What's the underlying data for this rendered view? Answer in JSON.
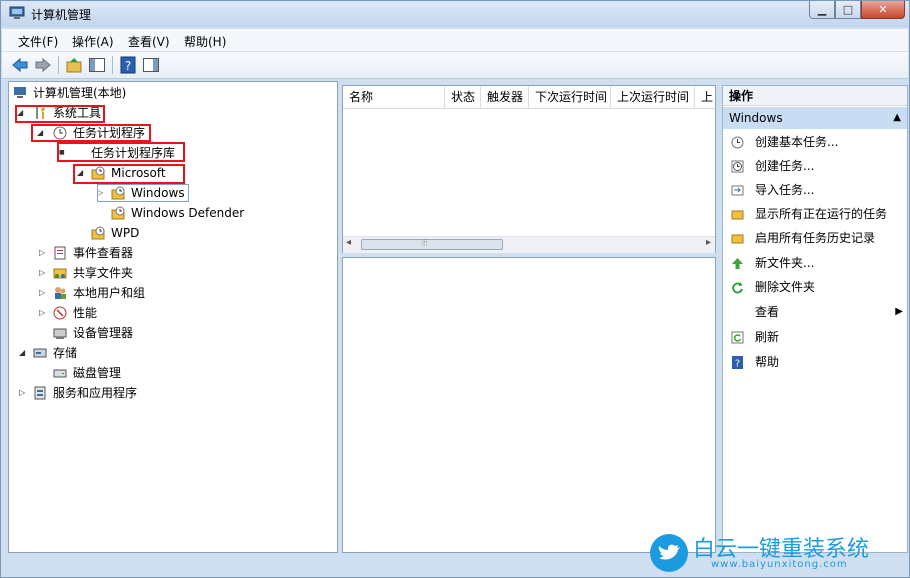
{
  "window": {
    "title": "计算机管理",
    "min_glyph": "▁",
    "max_glyph": "□",
    "close_glyph": "✕"
  },
  "menu": [
    "文件(F)",
    "操作(A)",
    "查看(V)",
    "帮助(H)"
  ],
  "tree": {
    "root": "计算机管理(本地)",
    "system_tools": "系统工具",
    "task_scheduler": "任务计划程序",
    "task_library": "任务计划程序库",
    "microsoft": "Microsoft",
    "windows": "Windows",
    "windows_defender": "Windows Defender",
    "wpd": "WPD",
    "event_viewer": "事件查看器",
    "shared_folders": "共享文件夹",
    "local_users": "本地用户和组",
    "performance": "性能",
    "device_manager": "设备管理器",
    "storage": "存储",
    "disk_management": "磁盘管理",
    "services_apps": "服务和应用程序"
  },
  "columns": [
    "名称",
    "状态",
    "触发器",
    "下次运行时间",
    "上次运行时间",
    "上"
  ],
  "scroll": {
    "left": "◂",
    "right": "▸",
    "grip": "⦙⦙⦙"
  },
  "actions": {
    "header": "操作",
    "section": "Windows",
    "section_arrow": "▲",
    "items": [
      "创建基本任务...",
      "创建任务...",
      "导入任务...",
      "显示所有正在运行的任务",
      "启用所有任务历史记录",
      "新文件夹...",
      "删除文件夹",
      "查看",
      "刷新",
      "帮助"
    ],
    "submenu_arrow": "▶"
  },
  "watermark": {
    "brand": "白云一键重装系统",
    "url": "www.baiyunxitong.com"
  },
  "colors": {
    "highlight_red": "#e8141c",
    "action_header_blue": "#c8dcf3",
    "accent_blue": "#1b9be0"
  }
}
